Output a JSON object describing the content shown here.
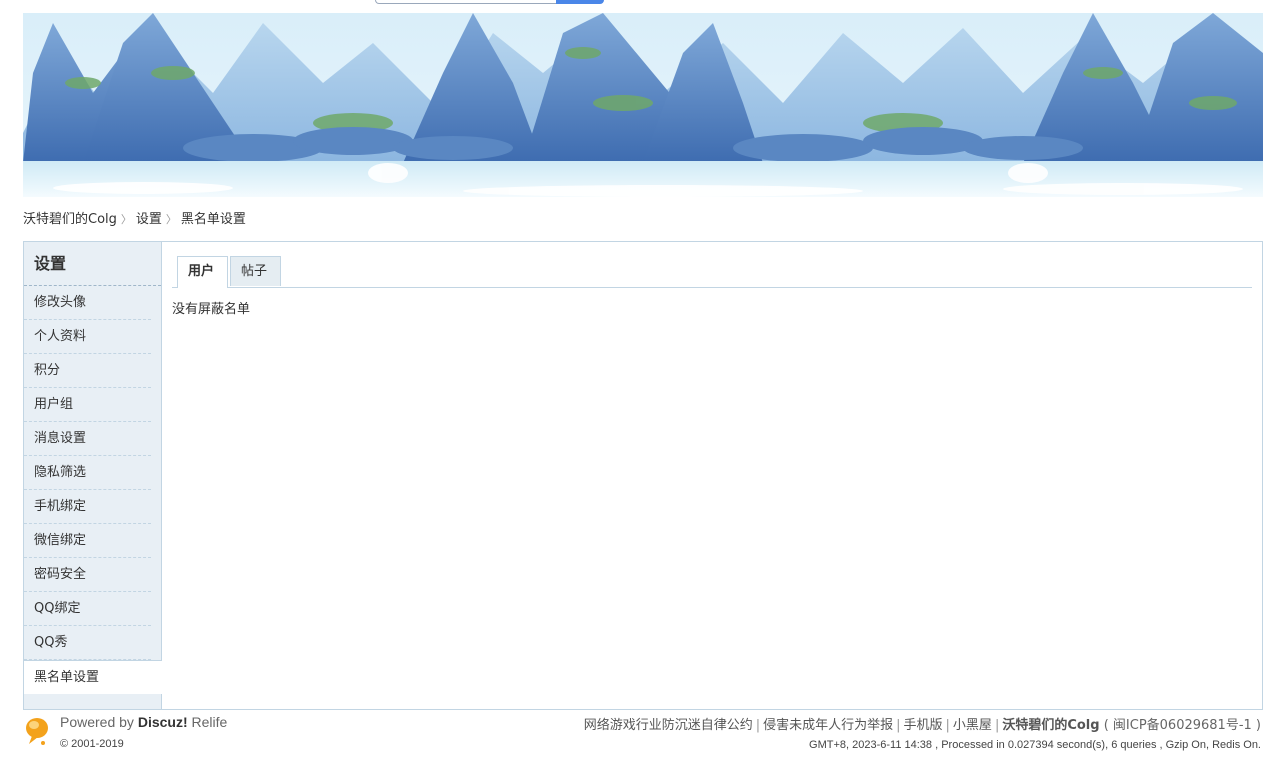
{
  "breadcrumb": {
    "home": "沃特碧们的Colg",
    "settings": "设置",
    "current": "黑名单设置",
    "separator": "〉"
  },
  "sidebar": {
    "title": "设置",
    "items": [
      {
        "label": "修改头像"
      },
      {
        "label": "个人资料"
      },
      {
        "label": "积分"
      },
      {
        "label": "用户组"
      },
      {
        "label": "消息设置"
      },
      {
        "label": "隐私筛选"
      },
      {
        "label": "手机绑定"
      },
      {
        "label": "微信绑定"
      },
      {
        "label": "密码安全"
      },
      {
        "label": "QQ绑定"
      },
      {
        "label": "QQ秀"
      },
      {
        "label": "黑名单设置"
      }
    ]
  },
  "tabs": {
    "user": "用户",
    "post": "帖子"
  },
  "content": {
    "empty_message": "没有屏蔽名单"
  },
  "footer": {
    "powered_prefix": "Powered by ",
    "powered_brand": "Discuz!",
    "powered_suffix": " Relife",
    "copyright": "© 2001-2019",
    "links": {
      "l1": "网络游戏行业防沉迷自律公约",
      "l2": "侵害未成年人行为举报",
      "l3": "手机版",
      "l4": "小黑屋",
      "site": "沃特碧们的Colg",
      "icp": "( 闽ICP备06029681号-1 )"
    },
    "stats": "GMT+8, 2023-6-11 14:38 , Processed in 0.027394 second(s), 6 queries , Gzip On, Redis On."
  },
  "colors": {
    "border": "#c2d5e3",
    "sidebar_bg": "#e8eff5",
    "accent": "#4a86e8"
  }
}
